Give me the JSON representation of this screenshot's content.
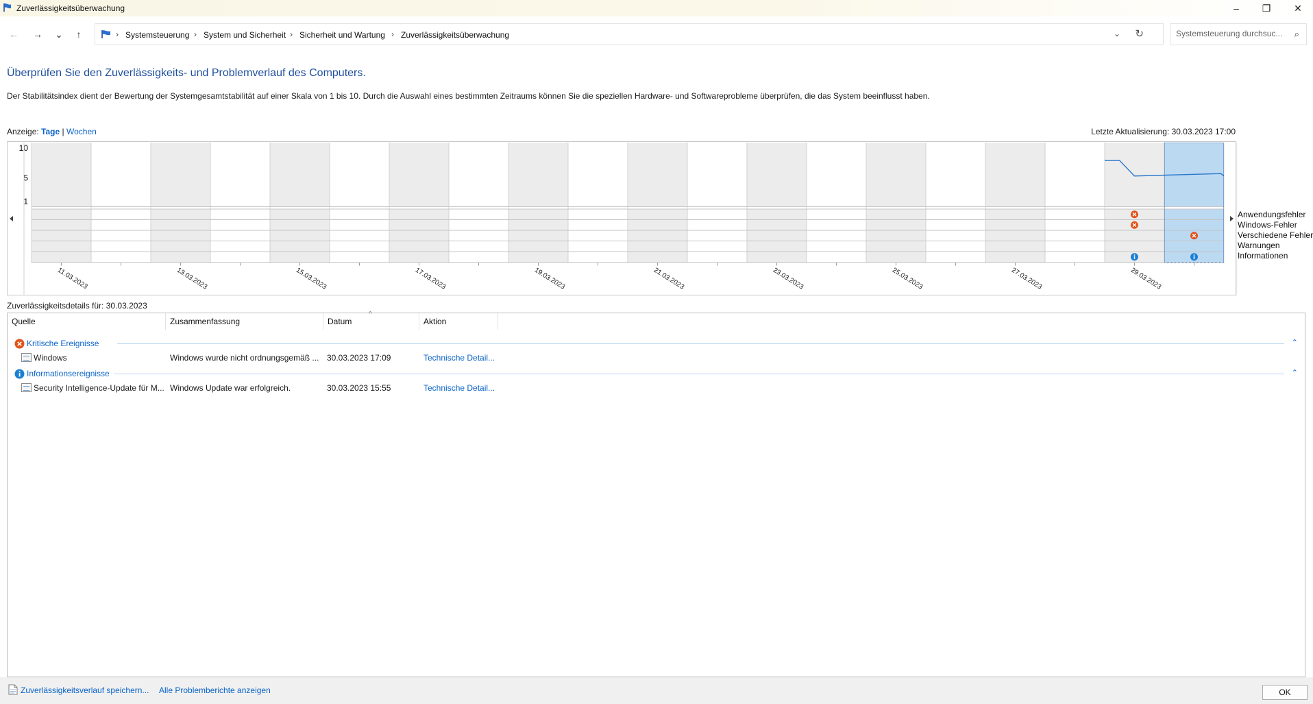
{
  "window": {
    "title": "Zuverlässigkeitsüberwachung",
    "minimize_glyph": "–",
    "maximize_glyph": "❐",
    "close_glyph": "✕"
  },
  "nav": {
    "back_glyph": "←",
    "forward_glyph": "→",
    "recent_glyph": "⌄",
    "up_glyph": "↑"
  },
  "address": {
    "crumbs": [
      "Systemsteuerung",
      "System und Sicherheit",
      "Sicherheit und Wartung",
      "Zuverlässigkeitsüberwachung"
    ],
    "separator": "›",
    "dropdown_glyph": "⌄",
    "refresh_glyph": "↻"
  },
  "search": {
    "placeholder": "Systemsteuerung durchsuc...",
    "icon": "⌕"
  },
  "header": {
    "title": "Überprüfen Sie den Zuverlässigkeits- und Problemverlauf des Computers.",
    "description": "Der Stabilitätsindex dient der Bewertung der Systemgesamtstabilität auf einer Skala von 1 bis 10. Durch die Auswahl eines bestimmten Zeitraums können Sie die speziellen Hardware- und Softwareprobleme überprüfen, die das System beeinflusst haben."
  },
  "view": {
    "label": "Anzeige:",
    "days": "Tage",
    "divider": "|",
    "weeks": "Wochen"
  },
  "last_update": "Letzte Aktualisierung: 30.03.2023 17:00",
  "chart_data": {
    "type": "line",
    "title": "",
    "y_ticks": [
      "10",
      "5",
      "1"
    ],
    "ylim": [
      1,
      10
    ],
    "date_labels": [
      "11.03.2023",
      "13.03.2023",
      "15.03.2023",
      "17.03.2023",
      "19.03.2023",
      "21.03.2023",
      "23.03.2023",
      "25.03.2023",
      "27.03.2023",
      "29.03.2023"
    ],
    "columns": 20,
    "selected_column": 19,
    "stability_index": [
      {
        "column": 18.0,
        "value": 7.9
      },
      {
        "column": 18.25,
        "value": 7.9
      },
      {
        "column": 18.5,
        "value": 5.3
      },
      {
        "column": 19.95,
        "value": 5.7
      },
      {
        "column": 20.0,
        "value": 5.3
      }
    ],
    "rows": [
      "Anwendungsfehler",
      "Windows-Fehler",
      "Verschiedene Fehler",
      "Warnungen",
      "Informationen"
    ],
    "events": [
      {
        "column": 18,
        "row": "Anwendungsfehler",
        "kind": "error"
      },
      {
        "column": 18,
        "row": "Windows-Fehler",
        "kind": "error"
      },
      {
        "column": 19,
        "row": "Verschiedene Fehler",
        "kind": "error"
      },
      {
        "column": 18,
        "row": "Informationen",
        "kind": "info"
      },
      {
        "column": 19,
        "row": "Informationen",
        "kind": "info"
      }
    ],
    "colors": {
      "gray_column": "#ececec",
      "selected": "#bcd9f2",
      "line": "#2a78c8",
      "error": "#e0541a",
      "info": "#1b7fd4"
    }
  },
  "details": {
    "label": "Zuverlässigkeitsdetails für: 30.03.2023",
    "columns": [
      "Quelle",
      "Zusammenfassung",
      "Datum",
      "Aktion"
    ],
    "groups": [
      {
        "name": "Kritische Ereignisse",
        "icon": "error-icon",
        "rows": [
          {
            "source": "Windows",
            "summary": "Windows wurde nicht ordnungsgemäß ...",
            "date": "30.03.2023 17:09",
            "action": "Technische Detail..."
          }
        ]
      },
      {
        "name": "Informationsereignisse",
        "icon": "info-icon",
        "rows": [
          {
            "source": "Security Intelligence-Update für M...",
            "summary": "Windows Update war erfolgreich.",
            "date": "30.03.2023 15:55",
            "action": "Technische Detail..."
          }
        ]
      }
    ],
    "collapse_glyph": "⌃",
    "sort_glyph": "^"
  },
  "footer": {
    "save_history": "Zuverlässigkeitsverlauf speichern...",
    "all_reports": "Alle Problemberichte anzeigen",
    "ok": "OK"
  }
}
